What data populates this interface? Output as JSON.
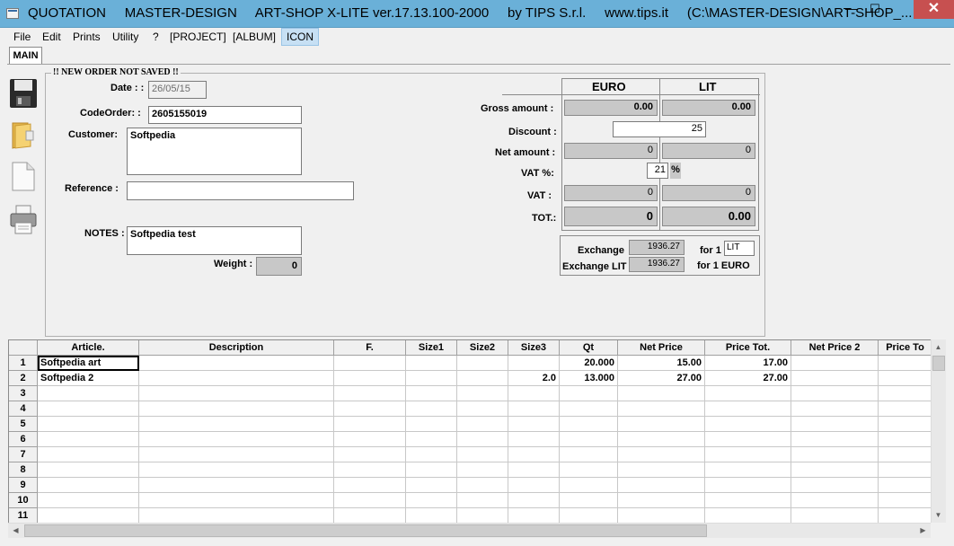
{
  "window": {
    "title": "QUOTATION     MASTER-DESIGN     ART-SHOP X-LITE ver.17.13.100-2000     by TIPS S.r.l.     www.tips.it     (C:\\MASTER-DESIGN\\ART-SHOP_...",
    "minimize_glyph": "—",
    "maximize_glyph": "☐",
    "close_glyph": "✕"
  },
  "menu": {
    "items": [
      "File",
      "Edit",
      "Prints",
      "Utility",
      "?",
      "[PROJECT]",
      "[ALBUM]",
      "ICON"
    ]
  },
  "tabs": {
    "main": "MAIN"
  },
  "toolbar": {
    "icons": [
      "save-icon",
      "folder-open-icon",
      "new-document-icon",
      "printer-icon"
    ]
  },
  "order": {
    "group_title": "!! NEW ORDER NOT SAVED !!",
    "date_label": "Date : :",
    "date_value": "26/05/15",
    "code_label": "CodeOrder: :",
    "code_value": "2605155019",
    "customer_label": "Customer:",
    "customer_value": "Softpedia",
    "reference_label": "Reference :",
    "reference_value": "",
    "notes_label": "NOTES :",
    "notes_value": "Softpedia test",
    "weight_label": "Weight :",
    "weight_value": "0"
  },
  "totals": {
    "euro_header": "EURO",
    "lit_header": "LIT",
    "gross_label": "Gross amount :",
    "gross_euro": "0.00",
    "gross_lit": "0.00",
    "discount_label": "Discount :",
    "discount_value": "25",
    "net_label": "Net amount :",
    "net_euro": "0",
    "net_lit": "0",
    "vat_pct_label": "VAT %:",
    "vat_pct_value": "21",
    "vat_pct_unit": "%",
    "vat_label": "VAT :",
    "vat_euro": "0",
    "vat_lit": "0",
    "tot_label": "TOT.:",
    "tot_euro": "0",
    "tot_lit": "0.00"
  },
  "exchange": {
    "exchange_label": "Exchange",
    "exchange_value": "1936.27",
    "for1_label": "for 1",
    "for1_unit": "LIT",
    "exchange_lit_label": "Exchange LIT",
    "exchange_lit_value": "1936.27",
    "for1_euro_label": "for 1 EURO"
  },
  "grid": {
    "columns": [
      "Article.",
      "Description",
      "F.",
      "Size1",
      "Size2",
      "Size3",
      "Qt",
      "Net Price",
      "Price Tot.",
      "Net Price 2",
      "Price To"
    ],
    "rows": [
      {
        "n": "1",
        "cells": [
          "Softpedia art",
          "",
          "",
          "",
          "",
          "",
          "20.000",
          "15.00",
          "17.00",
          "",
          ""
        ]
      },
      {
        "n": "2",
        "cells": [
          "Softpedia 2",
          "",
          "",
          "",
          "",
          "2.0",
          "13.000",
          "27.00",
          "27.00",
          "",
          ""
        ]
      },
      {
        "n": "3",
        "cells": [
          "",
          "",
          "",
          "",
          "",
          "",
          "",
          "",
          "",
          "",
          ""
        ]
      },
      {
        "n": "4",
        "cells": [
          "",
          "",
          "",
          "",
          "",
          "",
          "",
          "",
          "",
          "",
          ""
        ]
      },
      {
        "n": "5",
        "cells": [
          "",
          "",
          "",
          "",
          "",
          "",
          "",
          "",
          "",
          "",
          ""
        ]
      },
      {
        "n": "6",
        "cells": [
          "",
          "",
          "",
          "",
          "",
          "",
          "",
          "",
          "",
          "",
          ""
        ]
      },
      {
        "n": "7",
        "cells": [
          "",
          "",
          "",
          "",
          "",
          "",
          "",
          "",
          "",
          "",
          ""
        ]
      },
      {
        "n": "8",
        "cells": [
          "",
          "",
          "",
          "",
          "",
          "",
          "",
          "",
          "",
          "",
          ""
        ]
      },
      {
        "n": "9",
        "cells": [
          "",
          "",
          "",
          "",
          "",
          "",
          "",
          "",
          "",
          "",
          ""
        ]
      },
      {
        "n": "10",
        "cells": [
          "",
          "",
          "",
          "",
          "",
          "",
          "",
          "",
          "",
          "",
          ""
        ]
      },
      {
        "n": "11",
        "cells": [
          "",
          "",
          "",
          "",
          "",
          "",
          "",
          "",
          "",
          "",
          ""
        ]
      }
    ]
  },
  "scroll": {
    "up": "▲",
    "down": "▼",
    "left": "◀",
    "right": "▶"
  }
}
